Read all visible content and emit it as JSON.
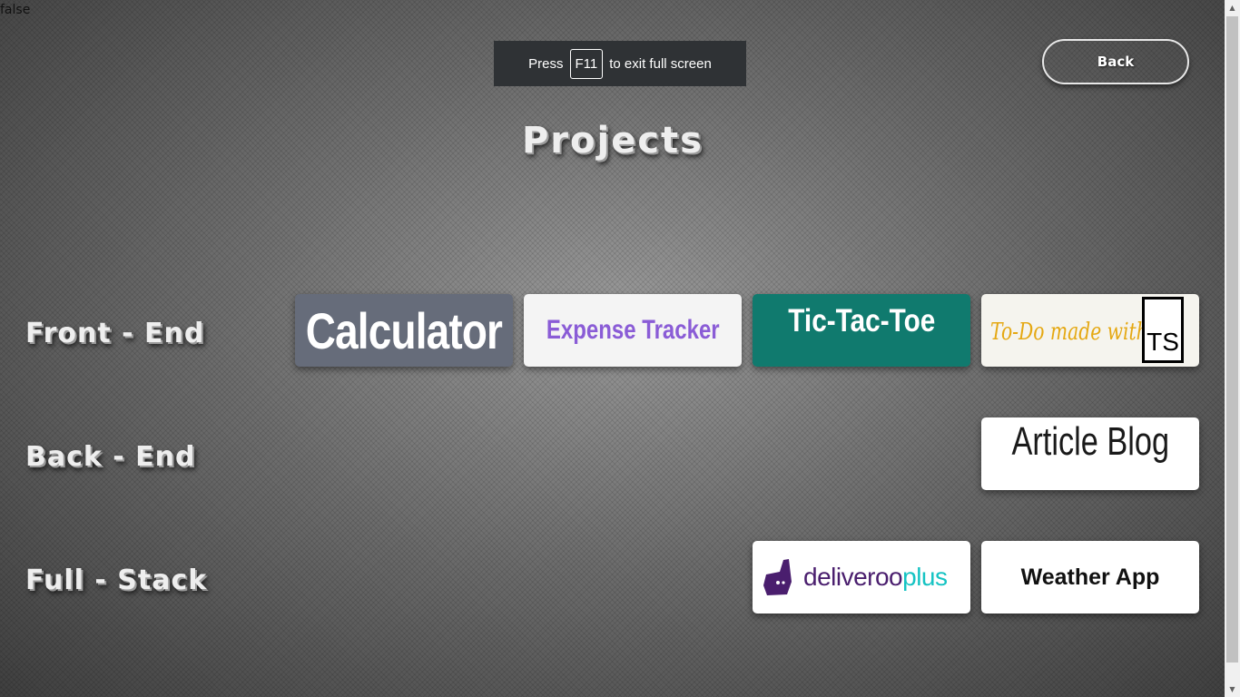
{
  "debug_text": "false",
  "fullscreen_toast": {
    "prefix": "Press",
    "key": "F11",
    "suffix": "to exit full screen"
  },
  "back_button": {
    "label": "Back"
  },
  "page_title": "Projects",
  "sections": {
    "front_end": {
      "label": "Front - End"
    },
    "back_end": {
      "label": "Back - End"
    },
    "full_stack": {
      "label": "Full - Stack"
    }
  },
  "cards": {
    "calculator": {
      "label": "Calculator",
      "color": "#666c7a"
    },
    "expense_tracker": {
      "label": "Expense Tracker",
      "color": "#8a5cd6"
    },
    "tic_tac_toe": {
      "label": "Tic-Tac-Toe",
      "color": "#107a6e"
    },
    "todo_ts": {
      "label": "To-Do made with",
      "badge": "TS",
      "color": "#e5a812"
    },
    "article_blog": {
      "label": "Article Blog"
    },
    "deliveroo_plus": {
      "brand_main": "deliveroo",
      "brand_plus": "plus",
      "icon": "deliveroo-kangaroo-icon",
      "color": "#4a1e6e",
      "accent": "#15c3c3"
    },
    "weather_app": {
      "label": "Weather App"
    }
  },
  "icons": {
    "scroll_up": "scroll-up-arrow-icon",
    "scroll_down": "scroll-down-arrow-icon"
  }
}
